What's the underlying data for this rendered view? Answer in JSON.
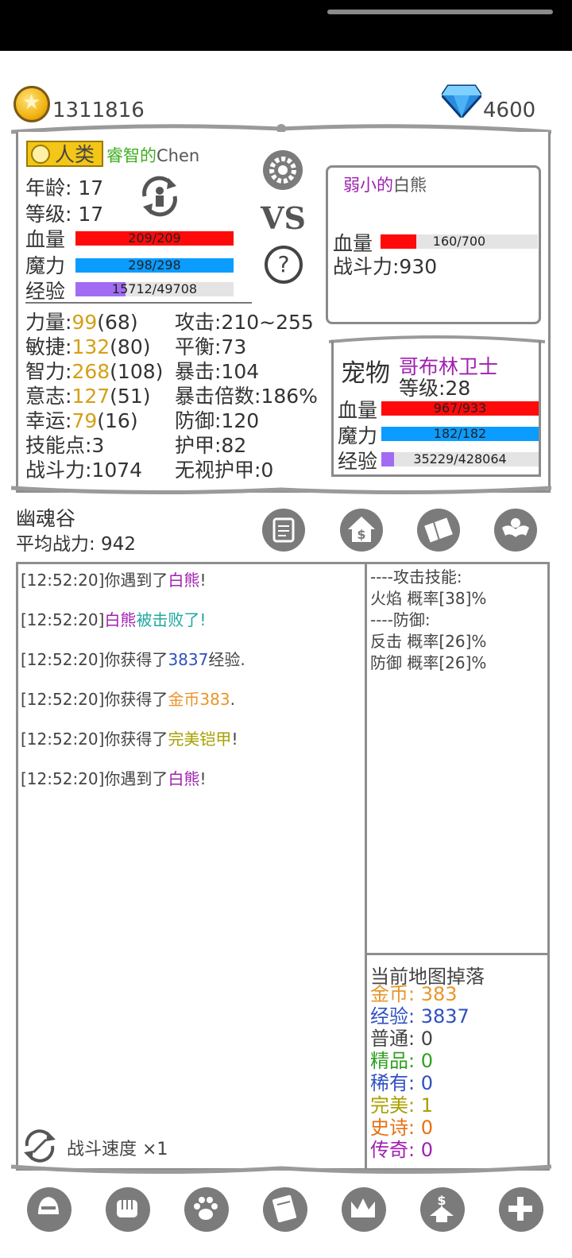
{
  "resources": {
    "gold": "1311816",
    "gems": "4600"
  },
  "player": {
    "race": "人类",
    "name": "睿智的",
    "name_suffix": "Chen",
    "age_label": "年龄",
    "age": "17",
    "level_label": "等级",
    "level": "17",
    "hp_label": "血量",
    "hp_text": "209/209",
    "hp_fraction": 1.0,
    "mp_label": "魔力",
    "mp_text": "298/298",
    "mp_fraction": 1.0,
    "exp_label": "经验",
    "exp_text": "15712/49708",
    "exp_fraction": 0.316
  },
  "stats_left": [
    {
      "label": "力量:",
      "value": "99",
      "base": "(68)"
    },
    {
      "label": "敏捷:",
      "value": "132",
      "base": "(80)"
    },
    {
      "label": "智力:",
      "value": "268",
      "base": "(108)"
    },
    {
      "label": "意志:",
      "value": "127",
      "base": "(51)"
    },
    {
      "label": "幸运:",
      "value": "79",
      "base": "(16)"
    },
    {
      "label": "技能点:3",
      "value": "",
      "base": ""
    },
    {
      "label": "战斗力:1074",
      "value": "",
      "base": ""
    }
  ],
  "stats_right": [
    "攻击:210~255",
    "平衡:73",
    "暴击:104",
    "暴击倍数:186%",
    "防御:120",
    "护甲:82",
    "无视护甲:0"
  ],
  "vs_label": "VS",
  "enemy": {
    "name_prefix": "弱小的",
    "name": "白熊",
    "hp_label": "血量",
    "hp_text": "160/700",
    "hp_fraction": 0.229,
    "power": "战斗力:930"
  },
  "pet": {
    "title": "宠物",
    "name": "哥布林卫士",
    "level": "等级:28",
    "hp_label": "血量",
    "hp_text": "967/933",
    "hp_fraction": 1.0,
    "mp_label": "魔力",
    "mp_text": "182/182",
    "mp_fraction": 1.0,
    "exp_label": "经验",
    "exp_text": "35229/428064",
    "exp_fraction": 0.082
  },
  "location": {
    "name": "幽魂谷",
    "avg_power": "平均战力: 942"
  },
  "log": [
    [
      {
        "t": "[12:52:20]你遇到了",
        "c": "#444"
      },
      {
        "t": "白熊",
        "c": "#a020b0"
      },
      {
        "t": "!",
        "c": "#444"
      }
    ],
    [
      {
        "t": "[12:52:20]",
        "c": "#444"
      },
      {
        "t": "白熊",
        "c": "#a020b0"
      },
      {
        "t": "被击败了!",
        "c": "#20a8a0"
      }
    ],
    [
      {
        "t": "[12:52:20]你获得了",
        "c": "#444"
      },
      {
        "t": "3837",
        "c": "#3050c0"
      },
      {
        "t": "经验.",
        "c": "#444"
      }
    ],
    [
      {
        "t": "[12:52:20]你获得了",
        "c": "#444"
      },
      {
        "t": "金币383",
        "c": "#e8962a"
      },
      {
        "t": ".",
        "c": "#444"
      }
    ],
    [
      {
        "t": "[12:52:20]你获得了",
        "c": "#444"
      },
      {
        "t": "完美铠甲",
        "c": "#a8a000"
      },
      {
        "t": "!",
        "c": "#444"
      }
    ],
    [
      {
        "t": "[12:52:20]你遇到了",
        "c": "#444"
      },
      {
        "t": "白熊",
        "c": "#a020b0"
      },
      {
        "t": "!",
        "c": "#444"
      }
    ]
  ],
  "skills": [
    "----攻击技能:",
    "火焰 概率[38]%",
    "----防御:",
    "反击 概率[26]%",
    "防御 概率[26]%"
  ],
  "drops": {
    "title": "当前地图掉落",
    "items": [
      {
        "label": "金币:",
        "value": "383",
        "color": "#e8962a"
      },
      {
        "label": "经验:",
        "value": "3837",
        "color": "#3050c0"
      },
      {
        "label": "普通:",
        "value": "0",
        "color": "#444444"
      },
      {
        "label": "精品:",
        "value": "0",
        "color": "#30a020"
      },
      {
        "label": "稀有:",
        "value": "0",
        "color": "#3050c0"
      },
      {
        "label": "完美:",
        "value": "1",
        "color": "#a8a000"
      },
      {
        "label": "史诗:",
        "value": "0",
        "color": "#e87010"
      },
      {
        "label": "传奇:",
        "value": "0",
        "color": "#a020b0"
      }
    ]
  },
  "battle_speed": "战斗速度 ×1",
  "bottom_nav": [
    "helmet-icon",
    "fist-icon",
    "paw-icon",
    "book-icon",
    "crown-icon",
    "upgrade-icon",
    "plus-icon"
  ]
}
